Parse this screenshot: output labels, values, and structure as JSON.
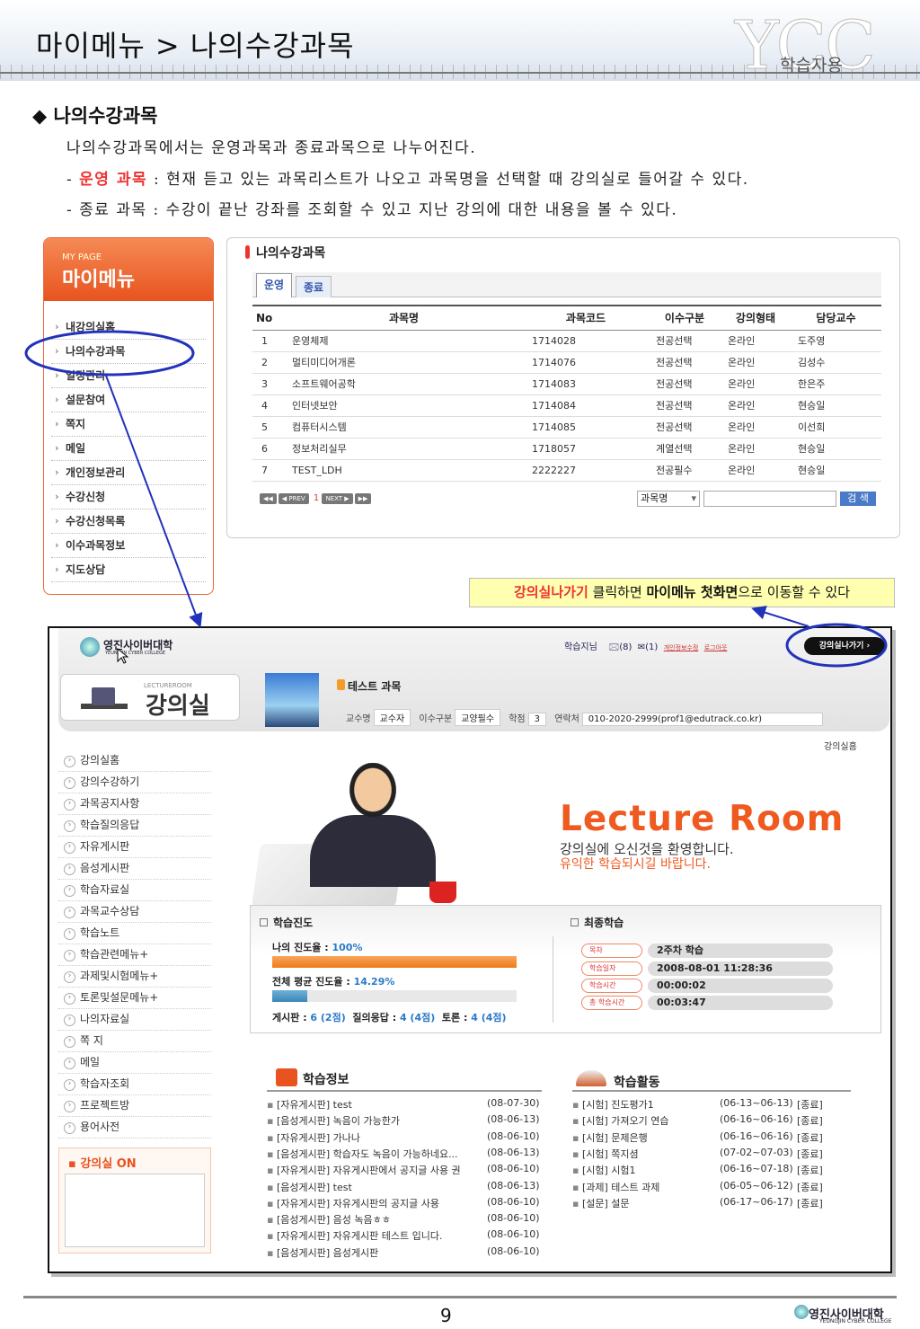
{
  "header": {
    "title": "마이메뉴 > 나의수강과목",
    "watermark": "YCC",
    "watermark_sub": "학습자용"
  },
  "section": {
    "heading": "나의수강과목",
    "line1": "나의수강과목에서는 운영과목과 종료과목으로 나누어진다.",
    "line2_prefix": "- ",
    "line2_red": "운영 과목",
    "line2_rest": " : 현재 듣고 있는 과목리스트가 나오고 과목명을 선택할 때 강의실로 들어갈 수 있다.",
    "line3": "- 종료 과목 : 수강이 끝난 강좌를 조회할 수 있고 지난 강의에 대한 내용을 볼 수 있다."
  },
  "mypage": {
    "en": "MY PAGE",
    "title": "마이메뉴",
    "items": [
      "내강의실홈",
      "나의수강과목",
      "일정관리",
      "설문참여",
      "쪽지",
      "메일",
      "개인정보관리",
      "수강신청",
      "수강신청목록",
      "이수과목정보",
      "지도상담"
    ]
  },
  "courses": {
    "title": "나의수강과목",
    "tabs": [
      "운영",
      "종료"
    ],
    "headers": [
      "No",
      "과목명",
      "과목코드",
      "이수구분",
      "강의형태",
      "담당교수"
    ],
    "rows": [
      [
        "1",
        "운영체제",
        "1714028",
        "전공선택",
        "온라인",
        "도주영"
      ],
      [
        "2",
        "멀티미디어개론",
        "1714076",
        "전공선택",
        "온라인",
        "김성수"
      ],
      [
        "3",
        "소프트웨어공학",
        "1714083",
        "전공선택",
        "온라인",
        "한은주"
      ],
      [
        "4",
        "인터넷보안",
        "1714084",
        "전공선택",
        "온라인",
        "현승일"
      ],
      [
        "5",
        "컴퓨터시스템",
        "1714085",
        "전공선택",
        "온라인",
        "이선희"
      ],
      [
        "6",
        "정보처리실무",
        "1718057",
        "계열선택",
        "온라인",
        "현승일"
      ],
      [
        "7",
        "TEST_LDH",
        "2222227",
        "전공필수",
        "온라인",
        "현승일"
      ]
    ],
    "pager": {
      "first": "◀◀",
      "prev": "◀ PREV",
      "page": "1",
      "next": "NEXT ▶",
      "last": "▶▶"
    },
    "search_select": "과목명",
    "search_button": "검 색"
  },
  "callout": {
    "part1": "강의실나가기",
    "part2": " 클릭하면 ",
    "part3": "마이메뉴 첫화면",
    "part4": "으로 이동할 수 있다"
  },
  "lecture": {
    "logo": "영진사이버대학",
    "logo_sub": "YEUNGJIN CYBER COLLEGE",
    "nav_guide": "학습지님",
    "nav_msg": "(8)",
    "nav_mail": "(1)",
    "nav_info": "개인정보수정",
    "nav_logout": "로그아웃",
    "exit_button": "강의실나가기 ›",
    "room_en": "LECTUREROOM",
    "room_ko": "강의실",
    "course_title": "테스트 과목",
    "info": {
      "prof_label": "교수명",
      "prof": "교수자",
      "type_label": "이수구분",
      "type": "교양필수",
      "credit_label": "학점",
      "credit": "3",
      "contact_label": "연락처",
      "contact": "010-2020-2999(prof1@edutrack.co.kr)"
    },
    "home_link": "강의실홈",
    "menu": [
      "강의실홈",
      "강의수강하기",
      "과목공지사항",
      "학습질의응답",
      "자유게시판",
      "음성게시판",
      "학습자료실",
      "과목교수상담",
      "학습노트",
      "학습관련메뉴+",
      "과제및시험메뉴+",
      "토론및설문메뉴+",
      "나의자료실",
      "쪽 지",
      "메일",
      "학습자조회",
      "프로젝트방",
      "용어사전"
    ],
    "on_title": "강의실 ON",
    "banner_title": "Lecture Room",
    "banner_line1": "강의실에 오신것을 환영합니다.",
    "banner_line2": "유익한 학습되시길 바랍니다.",
    "progress": {
      "heading": "학습진도",
      "my_label": "나의 진도율 : ",
      "my_value": "100%",
      "my_pct": 100,
      "avg_label": "전체 평균 진도율 : ",
      "avg_value": "14.29%",
      "avg_pct": 14.29,
      "counts_label1": "게시판 : ",
      "counts_val1": "6 (2점)",
      "counts_label2": "  질의응답 : ",
      "counts_val2": "4 (4점)",
      "counts_label3": "  토론 : ",
      "counts_val3": "4 (4점)"
    },
    "recent": {
      "heading": "최종학습",
      "rows": [
        [
          "목차",
          "2주차 학습"
        ],
        [
          "학습일자",
          "2008-08-01 11:28:36"
        ],
        [
          "학습시간",
          "00:00:02"
        ],
        [
          "총 학습시간",
          "00:03:47"
        ]
      ]
    },
    "info_board": {
      "heading": "학습정보",
      "items": [
        [
          "[자유게시판] test",
          "(08-07-30)"
        ],
        [
          "[음성게시판] 녹음이 가능한가",
          "(08-06-13)"
        ],
        [
          "[자유게시판] 가나나",
          "(08-06-10)"
        ],
        [
          "[음성게시판] 학습자도 녹음이 가능하네요...",
          "(08-06-13)"
        ],
        [
          "[자유게시판] 자유게시판에서 공지글 사용 권",
          "(08-06-10)"
        ],
        [
          "[음성게시판] test",
          "(08-06-13)"
        ],
        [
          "[자유게시판] 자유게시판의 공지글 사용",
          "(08-06-10)"
        ],
        [
          "[음성게시판] 음성 녹음ㅎㅎ",
          "(08-06-10)"
        ],
        [
          "[자유게시판] 자유게시판 테스트 입니다.",
          "(08-06-10)"
        ],
        [
          "[음성게시판] 음성게시판",
          "(08-06-10)"
        ]
      ]
    },
    "activity": {
      "heading": "학습활동",
      "items": [
        [
          "[시험] 진도평가1",
          "(06-13~06-13)",
          "[종료]"
        ],
        [
          "[시험] 가져오기 연습",
          "(06-16~06-16)",
          "[종료]"
        ],
        [
          "[시험] 문제은행",
          "(06-16~06-16)",
          "[종료]"
        ],
        [
          "[시험] 쪽지셤",
          "(07-02~07-03)",
          "[종료]"
        ],
        [
          "[시험] 시험1",
          "(06-16~07-18)",
          "[종료]"
        ],
        [
          "[과제] 테스트 과제",
          "(06-05~06-12)",
          "[종료]"
        ],
        [
          "[설문] 설문",
          "(06-17~06-17)",
          "[종료]"
        ]
      ]
    }
  },
  "footer": {
    "page": "9",
    "logo": "영진사이버대학",
    "logo_sub": "YEUNGJIN CYBER COLLEGE"
  },
  "colors": {
    "accent": "#e8531f",
    "link": "#2a7ac8",
    "highlight": "#ffffb0",
    "annotation": "#2233bb"
  }
}
